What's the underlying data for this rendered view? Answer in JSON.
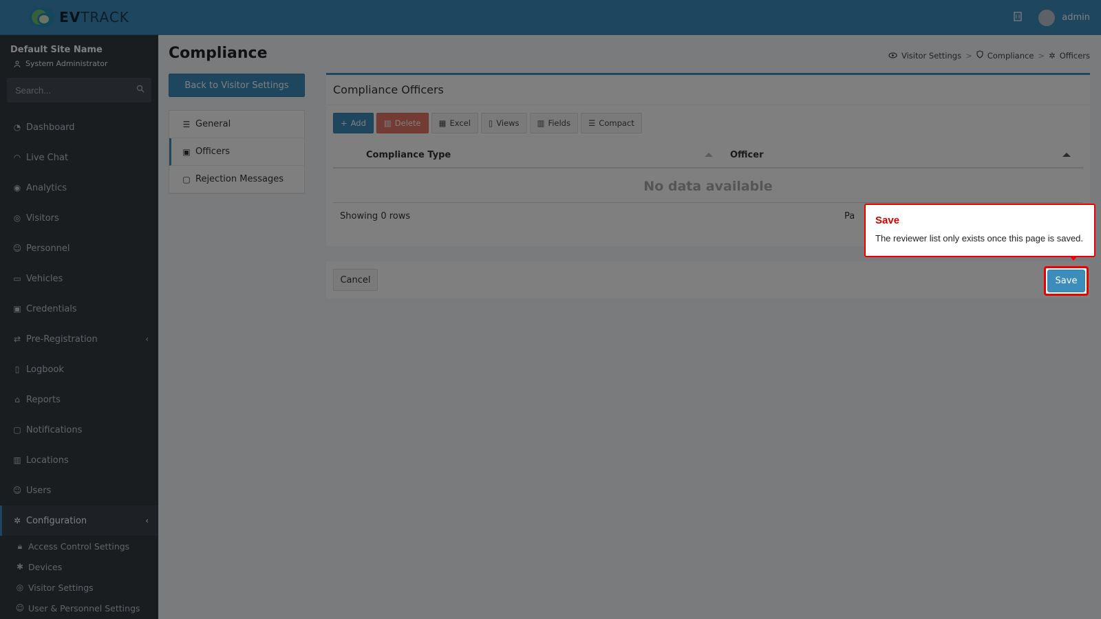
{
  "brand": {
    "logo_text_bold": "EV",
    "logo_text": "TRACK"
  },
  "site": {
    "name": "Default Site Name",
    "role": "System Administrator"
  },
  "search": {
    "placeholder": "Search..."
  },
  "nav": [
    {
      "label": "Dashboard",
      "icon": "dashboard-icon"
    },
    {
      "label": "Live Chat",
      "icon": "headset-icon"
    },
    {
      "label": "Analytics",
      "icon": "target-icon"
    },
    {
      "label": "Visitors",
      "icon": "eye-icon"
    },
    {
      "label": "Personnel",
      "icon": "user-group-icon"
    },
    {
      "label": "Vehicles",
      "icon": "car-icon"
    },
    {
      "label": "Credentials",
      "icon": "id-badge-icon"
    },
    {
      "label": "Pre-Registration",
      "icon": "arrows-icon"
    },
    {
      "label": "Logbook",
      "icon": "book-icon"
    },
    {
      "label": "Reports",
      "icon": "chart-icon"
    },
    {
      "label": "Notifications",
      "icon": "chat-icon"
    },
    {
      "label": "Locations",
      "icon": "map-icon"
    },
    {
      "label": "Users",
      "icon": "users-icon"
    },
    {
      "label": "Configuration",
      "icon": "gear-icon"
    }
  ],
  "subnav": [
    {
      "label": "Access Control Settings"
    },
    {
      "label": "Devices"
    },
    {
      "label": "Visitor Settings"
    },
    {
      "label": "User & Personnel Settings"
    }
  ],
  "topbar": {
    "username": "admin"
  },
  "page": {
    "title": "Compliance"
  },
  "breadcrumb": {
    "item1": "Visitor Settings",
    "item2": "Compliance",
    "item3": "Officers",
    "sep": ">"
  },
  "back_button": "Back to Visitor Settings",
  "side_menu": [
    {
      "label": "General"
    },
    {
      "label": "Officers"
    },
    {
      "label": "Rejection Messages"
    }
  ],
  "card": {
    "title": "Compliance Officers",
    "toolbar": {
      "add": "Add",
      "delete": "Delete",
      "excel": "Excel",
      "views": "Views",
      "fields": "Fields",
      "compact": "Compact"
    },
    "columns": [
      "Compliance Type",
      "Officer"
    ],
    "empty": "No data available",
    "showing": "Showing 0 rows",
    "pager_partial": "Pa"
  },
  "footer": {
    "cancel": "Cancel",
    "save": "Save"
  },
  "tooltip": {
    "title": "Save",
    "text": "The reviewer list only exists once this page is saved."
  },
  "colors": {
    "primary": "#3c8dbc",
    "sidebar": "#343a40",
    "danger": "#dd4b39",
    "highlight": "#ee0000"
  }
}
